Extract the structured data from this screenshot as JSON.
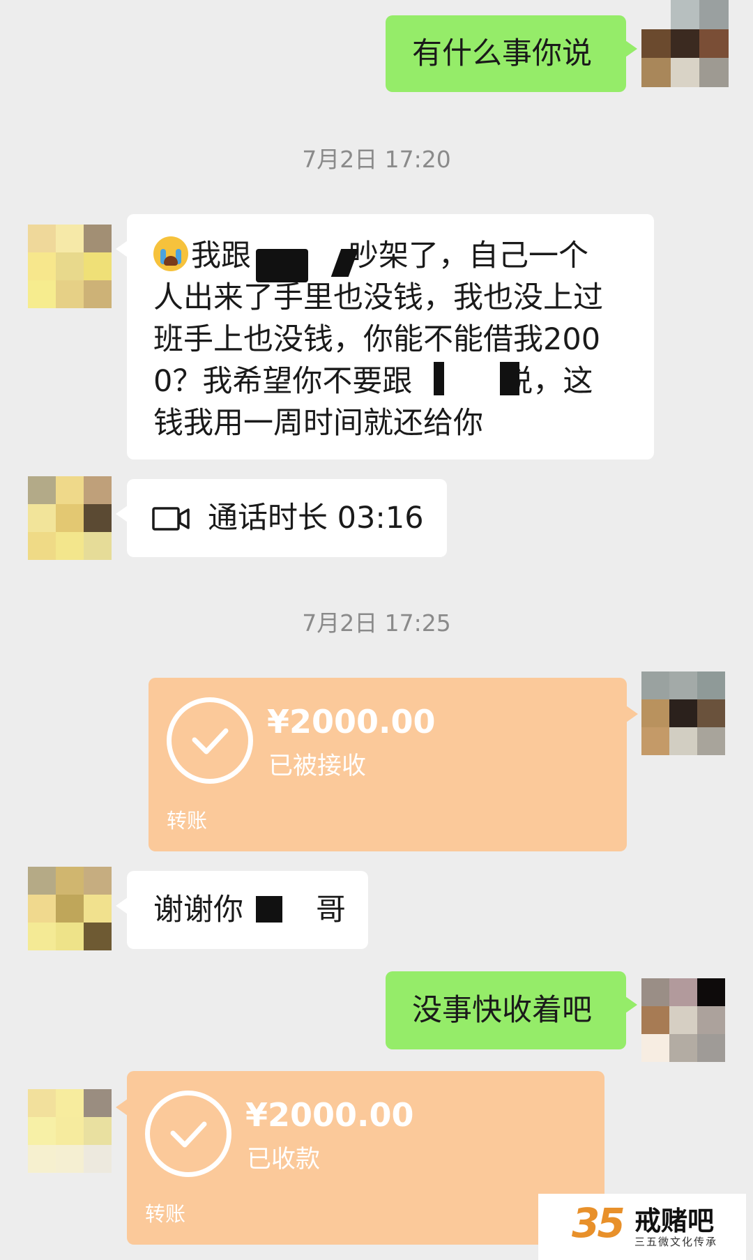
{
  "messages": {
    "m1": "有什么事你说",
    "time1": "7月2日 17:20",
    "m2": "我跟 吵架了，自己一个人出来了手里也没钱，我也没上过班手上也没钱，你能不能借我2000？我希望你不要跟 说，这钱我用一周时间就还给你",
    "m2_lines": [
      "我跟",
      "吵架了，自己一个",
      "人出来了手里也没钱，我也没上过",
      "班手上也没钱，你能不能借我200",
      "0？我希望你不要跟",
      "说，这",
      "钱我用一周时间就还给你"
    ],
    "call_label": "通话时长 03:16",
    "time2": "7月2日 17:25",
    "transfer1": {
      "amount": "¥2000.00",
      "status": "已被接收",
      "label": "转账"
    },
    "m3_a": "谢谢你",
    "m3_b": "哥",
    "m4": "没事快收着吧",
    "transfer2": {
      "amount": "¥2000.00",
      "status": "已收款",
      "label": "转账"
    }
  },
  "watermark": {
    "brand": "戒赌吧",
    "sub": "三五微文化传承",
    "number": "35"
  },
  "icons": {
    "video_call": "video-camera-icon",
    "check": "check-circle-icon",
    "emoji": "crying-face-emoji"
  },
  "colors": {
    "green_bubble": "#95ec69",
    "transfer_bg": "#fbc99a",
    "background": "#ededed"
  }
}
